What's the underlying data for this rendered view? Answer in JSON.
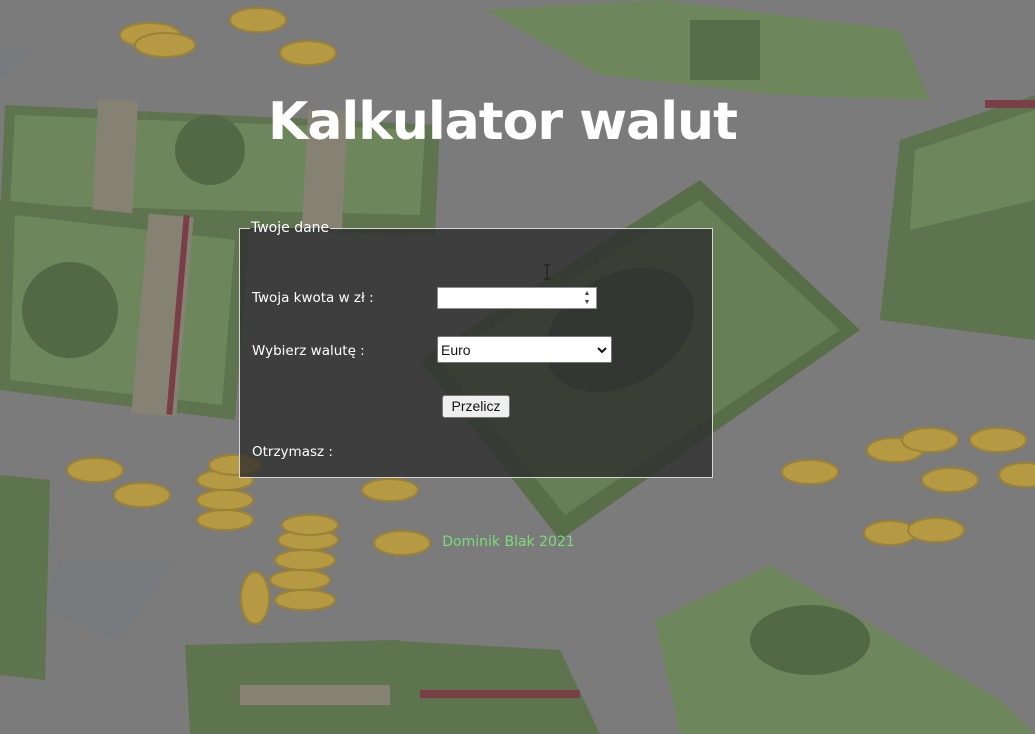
{
  "header": {
    "title": "Kalkulator walut"
  },
  "form": {
    "legend": "Twoje dane",
    "amount_label": "Twoja kwota w zł :",
    "amount_value": "",
    "currency_label": "Wybierz walutę :",
    "currency_selected": "Euro",
    "submit_label": "Przelicz",
    "result_label": "Otrzymasz :"
  },
  "footer": {
    "credit": "Dominik Blak 2021"
  },
  "colors": {
    "background": "#7b7b7b",
    "panel": "#2d2d2d",
    "title": "#ffffff",
    "footer_text": "#7cdb79",
    "bill_green": "#5d7a45",
    "coin_gold": "#c9a431"
  },
  "icons": {
    "select_arrow": "chevron-down-icon",
    "spinner": "spinner-arrows-icon",
    "cursor": "text-cursor-icon"
  }
}
